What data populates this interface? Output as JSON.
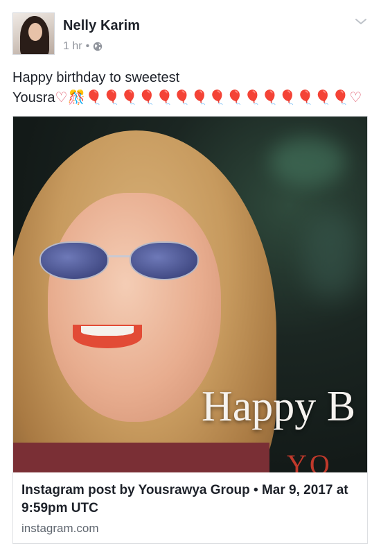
{
  "post": {
    "author": "Nelly Karim",
    "time": "1 hr",
    "separator": "•",
    "privacy_icon": "globe-icon",
    "menu_icon": "chevron-down-icon",
    "text_line1": "Happy birthday to sweetest",
    "text_name": "Yousra",
    "text_emojis": "♡🎊🎈🎈🎈🎈🎈🎈🎈🎈🎈🎈🎈🎈🎈🎈🎈♡"
  },
  "link_card": {
    "image_overlay_text": "Happy B",
    "image_overlay_sub": "YO",
    "title": "Instagram post by Yousrawya Group • Mar 9, 2017 at 9:59pm UTC",
    "domain": "instagram.com"
  },
  "colors": {
    "accent_text": "#1d2129",
    "meta_text": "#90949c",
    "heart": "#e0566a"
  }
}
